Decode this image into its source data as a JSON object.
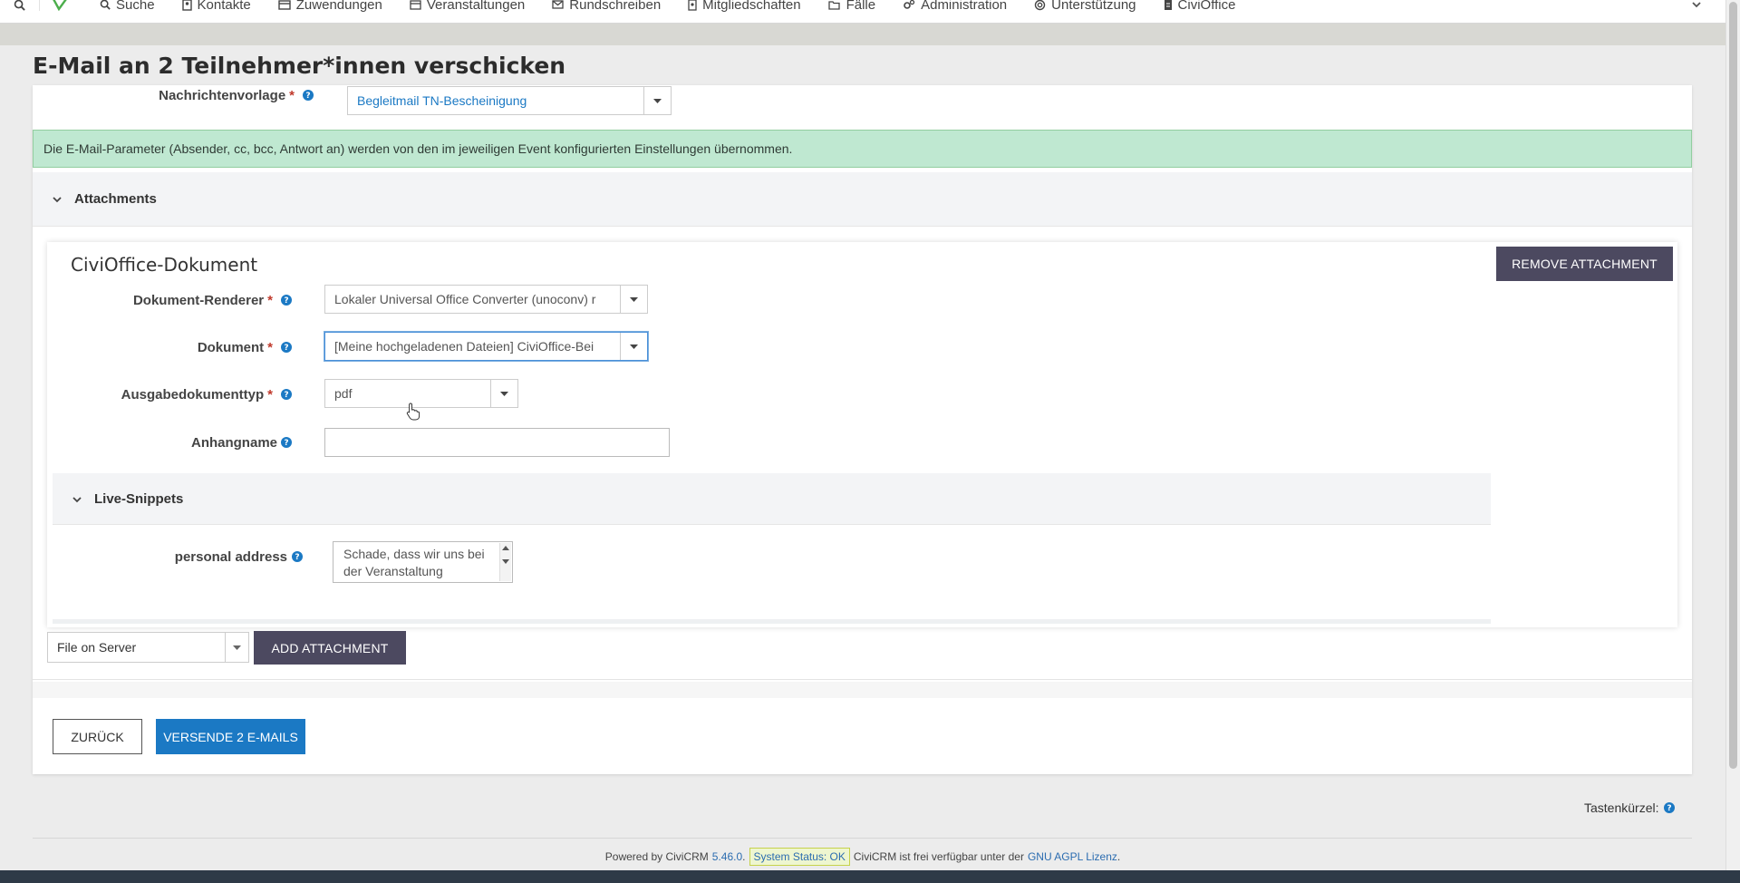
{
  "nav": {
    "items": [
      {
        "label": "Suche",
        "icon": "search-icon"
      },
      {
        "label": "Kontakte",
        "icon": "contact-card-icon"
      },
      {
        "label": "Zuwendungen",
        "icon": "credit-card-icon"
      },
      {
        "label": "Veranstaltungen",
        "icon": "calendar-icon"
      },
      {
        "label": "Rundschreiben",
        "icon": "envelope-icon"
      },
      {
        "label": "Mitgliedschaften",
        "icon": "id-badge-icon"
      },
      {
        "label": "Fälle",
        "icon": "folder-open-icon"
      },
      {
        "label": "Administration",
        "icon": "gears-icon"
      },
      {
        "label": "Unterstützung",
        "icon": "lifebuoy-icon"
      },
      {
        "label": "CiviOffice",
        "icon": "document-icon"
      }
    ]
  },
  "page": {
    "title": "E-Mail an 2 Teilnehmer*innen verschicken"
  },
  "form": {
    "template_label": "Nachrichtenvorlage",
    "template_value": "Begleitmail TN-Bescheinigung",
    "required_mark": "*",
    "info_message": "Die E-Mail-Parameter (Absender, cc, bcc, Antwort an) werden von den im jeweiligen Event konfigurierten Einstellungen übernommen."
  },
  "attachments": {
    "section_title": "Attachments",
    "civioffice": {
      "title": "CiviOffice-Dokument",
      "remove_label": "REMOVE ATTACHMENT",
      "renderer_label": "Dokument-Renderer",
      "renderer_value": "Lokaler Universal Office Converter (unoconv) r",
      "document_label": "Dokument",
      "document_value": "[Meine hochgeladenen Dateien] CiviOffice-Bei",
      "output_type_label": "Ausgabedokumenttyp",
      "output_type_value": "pdf",
      "attachment_name_label": "Anhangname",
      "attachment_name_value": "",
      "live_snippets_title": "Live-Snippets",
      "personal_address_label": "personal address",
      "personal_address_value": "Schade, dass wir uns bei der Veranstaltung"
    },
    "add_type_value": "File on Server",
    "add_label": "ADD ATTACHMENT"
  },
  "actions": {
    "back_label": "ZURÜCK",
    "send_label": "VERSENDE 2 E-MAILS"
  },
  "footer": {
    "shortcuts_label": "Tastenkürzel:",
    "powered_by": "Powered by CiviCRM",
    "version": "5.46.0",
    "status": "System Status: OK",
    "license_text": "CiviCRM ist frei verfügbar unter der",
    "license_link": "GNU AGPL Lizenz"
  },
  "colors": {
    "accent_blue": "#1b79c4",
    "dark_button": "#4c4960",
    "info_green": "#bfe8d1",
    "required_red": "#c0392b",
    "logo_green": "#4cae4c"
  }
}
